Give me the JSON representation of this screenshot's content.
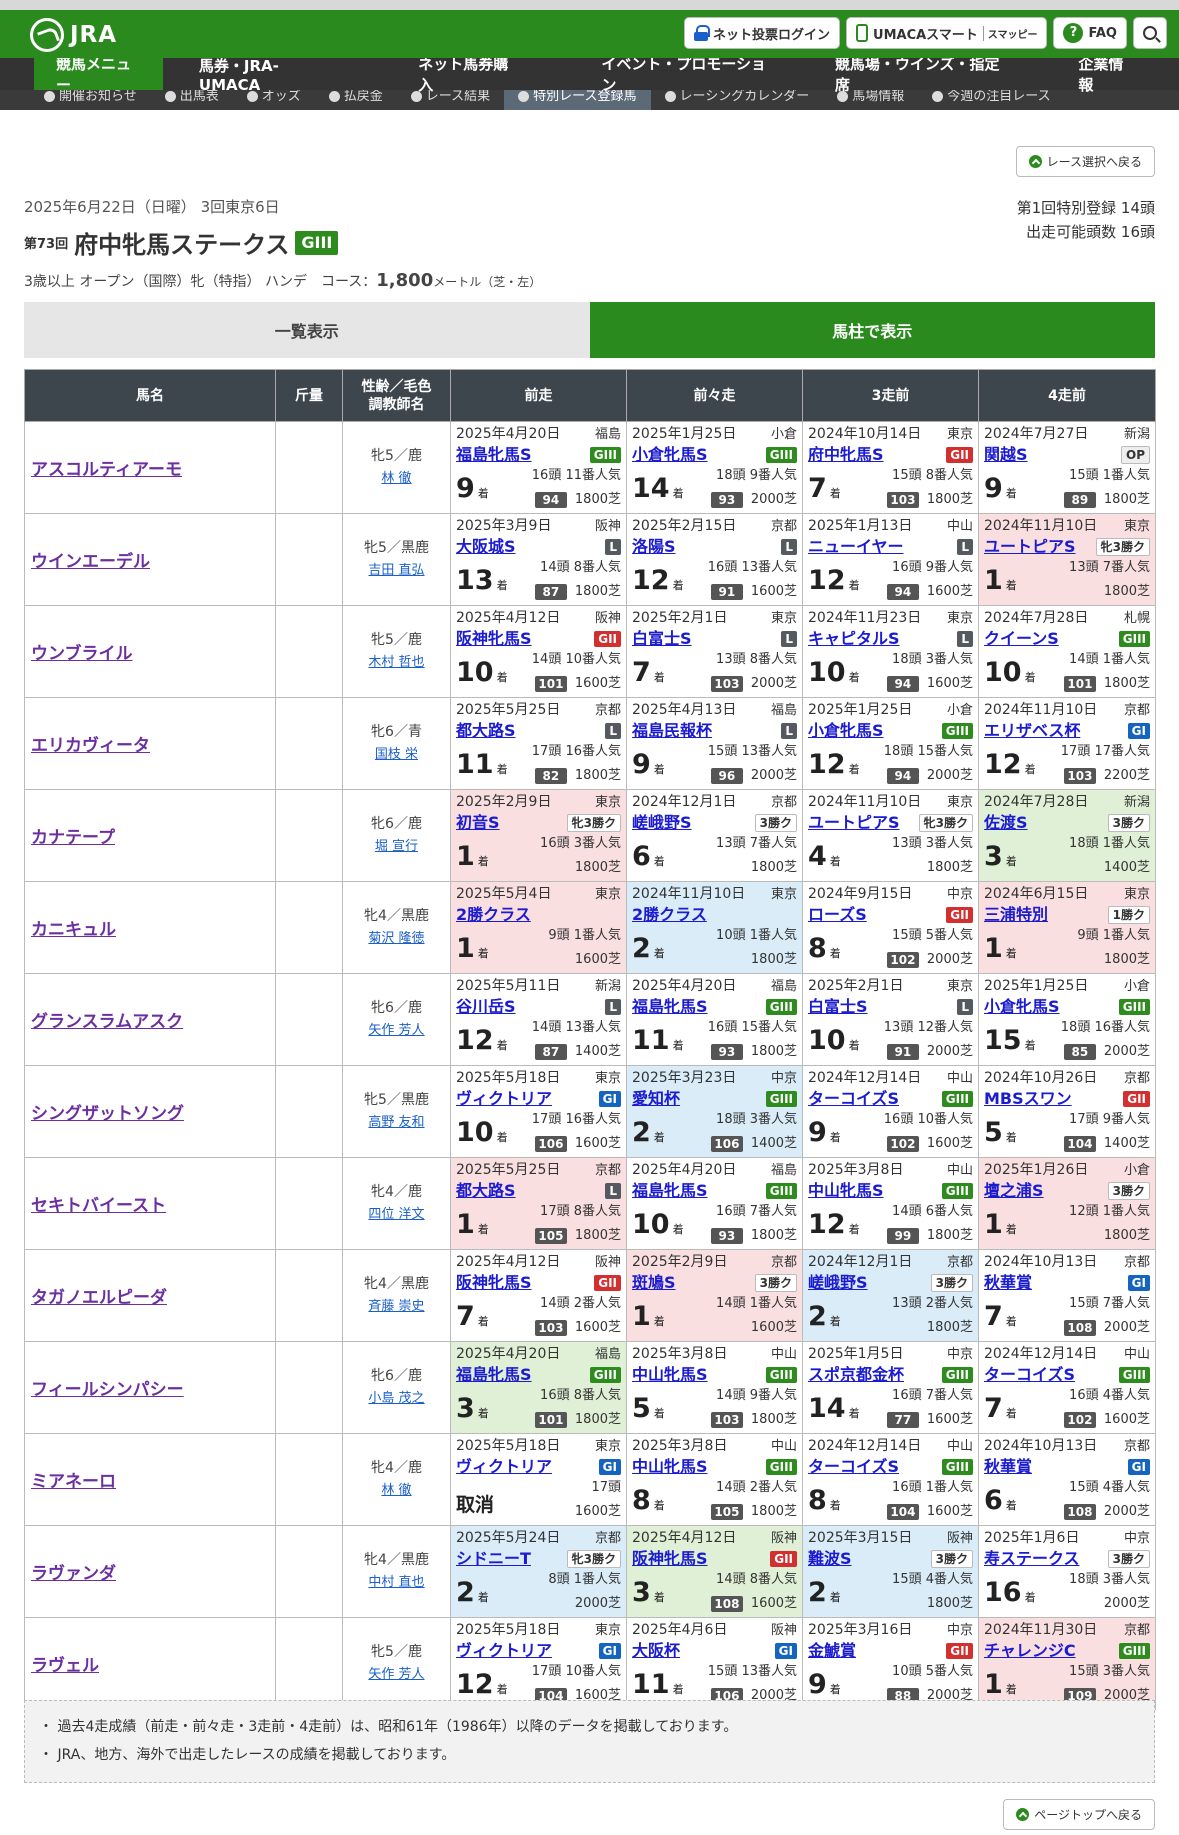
{
  "header": {
    "logo": "JRA",
    "login": "ネット投票ログイン",
    "umaca": "UMACAスマート",
    "smappy": "スマッピー",
    "faq": "FAQ"
  },
  "nav": [
    "競馬メニュー",
    "馬券・JRA-UMACA",
    "ネット馬券購入",
    "イベント・プロモーション",
    "競馬場・ウインズ・指定席",
    "企業情報"
  ],
  "subnav": [
    "開催お知らせ",
    "出馬表",
    "オッズ",
    "払戻金",
    "レース結果",
    "特別レース登録馬",
    "レーシングカレンダー",
    "馬場情報",
    "今週の注目レース"
  ],
  "back_label": "レース選択へ戻る",
  "race": {
    "date": "2025年6月22日（日曜） 3回東京6日",
    "number": "第73回",
    "name": "府中牝馬ステークス",
    "grade": "GIII",
    "cond_prefix": "3歳以上 オープン（国際）牝（特指） ハンデ　コース：",
    "distance": "1,800",
    "cond_suffix": "メートル（芝・左）",
    "reg1": "第1回特別登録 14頭",
    "reg2": "出走可能頭数 16頭"
  },
  "tabs": {
    "list": "一覧表示",
    "column": "馬柱で表示"
  },
  "columns": {
    "name": "馬名",
    "weight": "斤量",
    "attr": "性齢／毛色\n調教師名",
    "prev1": "前走",
    "prev2": "前々走",
    "prev3": "3走前",
    "prev4": "4走前"
  },
  "horses": [
    {
      "name": "アスコルティアーモ",
      "sex": "牝5／鹿",
      "trainer": "林 徹",
      "races": [
        {
          "d": "2025年4月20日",
          "v": "福島",
          "n": "福島牝馬S",
          "g": "GIII",
          "p": "9",
          "h": "16頭 11番人気",
          "r": "94",
          "c": "1800芝",
          "bg": ""
        },
        {
          "d": "2025年1月25日",
          "v": "小倉",
          "n": "小倉牝馬S",
          "g": "GIII",
          "p": "14",
          "h": "18頭 9番人気",
          "r": "93",
          "c": "2000芝",
          "bg": ""
        },
        {
          "d": "2024年10月14日",
          "v": "東京",
          "n": "府中牝馬S",
          "g": "GII",
          "p": "7",
          "h": "15頭 8番人気",
          "r": "103",
          "c": "1800芝",
          "bg": ""
        },
        {
          "d": "2024年7月27日",
          "v": "新潟",
          "n": "関越S",
          "g": "OP",
          "p": "9",
          "h": "15頭 1番人気",
          "r": "89",
          "c": "1800芝",
          "bg": ""
        }
      ]
    },
    {
      "name": "ウインエーデル",
      "sex": "牝5／黒鹿",
      "trainer": "吉田 直弘",
      "races": [
        {
          "d": "2025年3月9日",
          "v": "阪神",
          "n": "大阪城S",
          "g": "L",
          "p": "13",
          "h": "14頭 8番人気",
          "r": "87",
          "c": "1800芝",
          "bg": ""
        },
        {
          "d": "2025年2月15日",
          "v": "京都",
          "n": "洛陽S",
          "g": "L",
          "p": "12",
          "h": "16頭 13番人気",
          "r": "91",
          "c": "1600芝",
          "bg": ""
        },
        {
          "d": "2025年1月13日",
          "v": "中山",
          "n": "ニューイヤー",
          "g": "L",
          "p": "12",
          "h": "16頭 9番人気",
          "r": "94",
          "c": "1600芝",
          "bg": ""
        },
        {
          "d": "2024年11月10日",
          "v": "東京",
          "n": "ユートピアS",
          "g": "牝3勝ク",
          "p": "1",
          "h": "13頭 7番人気",
          "r": "",
          "c": "1800芝",
          "bg": "w"
        }
      ]
    },
    {
      "name": "ウンブライル",
      "sex": "牝5／鹿",
      "trainer": "木村 哲也",
      "races": [
        {
          "d": "2025年4月12日",
          "v": "阪神",
          "n": "阪神牝馬S",
          "g": "GII",
          "p": "10",
          "h": "14頭 10番人気",
          "r": "101",
          "c": "1600芝",
          "bg": ""
        },
        {
          "d": "2025年2月1日",
          "v": "東京",
          "n": "白富士S",
          "g": "L",
          "p": "7",
          "h": "13頭 8番人気",
          "r": "103",
          "c": "2000芝",
          "bg": ""
        },
        {
          "d": "2024年11月23日",
          "v": "東京",
          "n": "キャピタルS",
          "g": "L",
          "p": "10",
          "h": "18頭 3番人気",
          "r": "94",
          "c": "1600芝",
          "bg": ""
        },
        {
          "d": "2024年7月28日",
          "v": "札幌",
          "n": "クイーンS",
          "g": "GIII",
          "p": "10",
          "h": "14頭 1番人気",
          "r": "101",
          "c": "1800芝",
          "bg": ""
        }
      ]
    },
    {
      "name": "エリカヴィータ",
      "sex": "牝6／青",
      "trainer": "国枝 栄",
      "races": [
        {
          "d": "2025年5月25日",
          "v": "京都",
          "n": "都大路S",
          "g": "L",
          "p": "11",
          "h": "17頭 16番人気",
          "r": "82",
          "c": "1800芝",
          "bg": ""
        },
        {
          "d": "2025年4月13日",
          "v": "福島",
          "n": "福島民報杯",
          "g": "L",
          "p": "9",
          "h": "15頭 13番人気",
          "r": "96",
          "c": "2000芝",
          "bg": ""
        },
        {
          "d": "2025年1月25日",
          "v": "小倉",
          "n": "小倉牝馬S",
          "g": "GIII",
          "p": "12",
          "h": "18頭 15番人気",
          "r": "94",
          "c": "2000芝",
          "bg": ""
        },
        {
          "d": "2024年11月10日",
          "v": "京都",
          "n": "エリザベス杯",
          "g": "GI",
          "p": "12",
          "h": "17頭 17番人気",
          "r": "103",
          "c": "2200芝",
          "bg": ""
        }
      ]
    },
    {
      "name": "カナテープ",
      "sex": "牝6／鹿",
      "trainer": "堀 宣行",
      "races": [
        {
          "d": "2025年2月9日",
          "v": "東京",
          "n": "初音S",
          "g": "牝3勝ク",
          "p": "1",
          "h": "16頭 3番人気",
          "r": "",
          "c": "1800芝",
          "bg": "w"
        },
        {
          "d": "2024年12月1日",
          "v": "京都",
          "n": "嵯峨野S",
          "g": "3勝ク",
          "p": "6",
          "h": "13頭 7番人気",
          "r": "",
          "c": "1800芝",
          "bg": ""
        },
        {
          "d": "2024年11月10日",
          "v": "東京",
          "n": "ユートピアS",
          "g": "牝3勝ク",
          "p": "4",
          "h": "13頭 3番人気",
          "r": "",
          "c": "1800芝",
          "bg": ""
        },
        {
          "d": "2024年7月28日",
          "v": "新潟",
          "n": "佐渡S",
          "g": "3勝ク",
          "p": "3",
          "h": "18頭 1番人気",
          "r": "",
          "c": "1400芝",
          "bg": "p3"
        }
      ]
    },
    {
      "name": "カニキュル",
      "sex": "牝4／黒鹿",
      "trainer": "菊沢 隆徳",
      "races": [
        {
          "d": "2025年5月4日",
          "v": "東京",
          "n": "2勝クラス",
          "g": "",
          "p": "1",
          "h": "9頭 1番人気",
          "r": "",
          "c": "1600芝",
          "bg": "w"
        },
        {
          "d": "2024年11月10日",
          "v": "東京",
          "n": "2勝クラス",
          "g": "",
          "p": "2",
          "h": "10頭 1番人気",
          "r": "",
          "c": "1800芝",
          "bg": "p2"
        },
        {
          "d": "2024年9月15日",
          "v": "中京",
          "n": "ローズS",
          "g": "GII",
          "p": "8",
          "h": "15頭 5番人気",
          "r": "102",
          "c": "2000芝",
          "bg": ""
        },
        {
          "d": "2024年6月15日",
          "v": "東京",
          "n": "三浦特別",
          "g": "1勝ク",
          "p": "1",
          "h": "9頭 1番人気",
          "r": "",
          "c": "1800芝",
          "bg": "w"
        }
      ]
    },
    {
      "name": "グランスラムアスク",
      "sex": "牝6／鹿",
      "trainer": "矢作 芳人",
      "races": [
        {
          "d": "2025年5月11日",
          "v": "新潟",
          "n": "谷川岳S",
          "g": "L",
          "p": "12",
          "h": "14頭 13番人気",
          "r": "87",
          "c": "1400芝",
          "bg": ""
        },
        {
          "d": "2025年4月20日",
          "v": "福島",
          "n": "福島牝馬S",
          "g": "GIII",
          "p": "11",
          "h": "16頭 15番人気",
          "r": "93",
          "c": "1800芝",
          "bg": ""
        },
        {
          "d": "2025年2月1日",
          "v": "東京",
          "n": "白富士S",
          "g": "L",
          "p": "10",
          "h": "13頭 12番人気",
          "r": "91",
          "c": "2000芝",
          "bg": ""
        },
        {
          "d": "2025年1月25日",
          "v": "小倉",
          "n": "小倉牝馬S",
          "g": "GIII",
          "p": "15",
          "h": "18頭 16番人気",
          "r": "85",
          "c": "2000芝",
          "bg": ""
        }
      ]
    },
    {
      "name": "シングザットソング",
      "sex": "牝5／黒鹿",
      "trainer": "高野 友和",
      "races": [
        {
          "d": "2025年5月18日",
          "v": "東京",
          "n": "ヴィクトリア",
          "g": "GI",
          "p": "10",
          "h": "17頭 16番人気",
          "r": "106",
          "c": "1600芝",
          "bg": ""
        },
        {
          "d": "2025年3月23日",
          "v": "中京",
          "n": "愛知杯",
          "g": "GIII",
          "p": "2",
          "h": "18頭 3番人気",
          "r": "106",
          "c": "1400芝",
          "bg": "p2"
        },
        {
          "d": "2024年12月14日",
          "v": "中山",
          "n": "ターコイズS",
          "g": "GIII",
          "p": "9",
          "h": "16頭 10番人気",
          "r": "102",
          "c": "1600芝",
          "bg": ""
        },
        {
          "d": "2024年10月26日",
          "v": "京都",
          "n": "MBSスワン",
          "g": "GII",
          "p": "5",
          "h": "17頭 9番人気",
          "r": "104",
          "c": "1400芝",
          "bg": ""
        }
      ]
    },
    {
      "name": "セキトバイースト",
      "sex": "牝4／鹿",
      "trainer": "四位 洋文",
      "races": [
        {
          "d": "2025年5月25日",
          "v": "京都",
          "n": "都大路S",
          "g": "L",
          "p": "1",
          "h": "17頭 8番人気",
          "r": "105",
          "c": "1800芝",
          "bg": "w"
        },
        {
          "d": "2025年4月20日",
          "v": "福島",
          "n": "福島牝馬S",
          "g": "GIII",
          "p": "10",
          "h": "16頭 7番人気",
          "r": "93",
          "c": "1800芝",
          "bg": ""
        },
        {
          "d": "2025年3月8日",
          "v": "中山",
          "n": "中山牝馬S",
          "g": "GIII",
          "p": "12",
          "h": "14頭 6番人気",
          "r": "99",
          "c": "1800芝",
          "bg": ""
        },
        {
          "d": "2025年1月26日",
          "v": "小倉",
          "n": "壇之浦S",
          "g": "3勝ク",
          "p": "1",
          "h": "12頭 1番人気",
          "r": "",
          "c": "1800芝",
          "bg": "w"
        }
      ]
    },
    {
      "name": "タガノエルピーダ",
      "sex": "牝4／黒鹿",
      "trainer": "斉藤 崇史",
      "races": [
        {
          "d": "2025年4月12日",
          "v": "阪神",
          "n": "阪神牝馬S",
          "g": "GII",
          "p": "7",
          "h": "14頭 2番人気",
          "r": "103",
          "c": "1600芝",
          "bg": ""
        },
        {
          "d": "2025年2月9日",
          "v": "京都",
          "n": "斑鳩S",
          "g": "3勝ク",
          "p": "1",
          "h": "14頭 1番人気",
          "r": "",
          "c": "1600芝",
          "bg": "w"
        },
        {
          "d": "2024年12月1日",
          "v": "京都",
          "n": "嵯峨野S",
          "g": "3勝ク",
          "p": "2",
          "h": "13頭 2番人気",
          "r": "",
          "c": "1800芝",
          "bg": "p2"
        },
        {
          "d": "2024年10月13日",
          "v": "京都",
          "n": "秋華賞",
          "g": "GI",
          "p": "7",
          "h": "15頭 7番人気",
          "r": "108",
          "c": "2000芝",
          "bg": ""
        }
      ]
    },
    {
      "name": "フィールシンパシー",
      "sex": "牝6／鹿",
      "trainer": "小島 茂之",
      "races": [
        {
          "d": "2025年4月20日",
          "v": "福島",
          "n": "福島牝馬S",
          "g": "GIII",
          "p": "3",
          "h": "16頭 8番人気",
          "r": "101",
          "c": "1800芝",
          "bg": "p3"
        },
        {
          "d": "2025年3月8日",
          "v": "中山",
          "n": "中山牝馬S",
          "g": "GIII",
          "p": "5",
          "h": "14頭 9番人気",
          "r": "103",
          "c": "1800芝",
          "bg": ""
        },
        {
          "d": "2025年1月5日",
          "v": "中京",
          "n": "スポ京都金杯",
          "g": "GIII",
          "p": "14",
          "h": "16頭 7番人気",
          "r": "77",
          "c": "1600芝",
          "bg": ""
        },
        {
          "d": "2024年12月14日",
          "v": "中山",
          "n": "ターコイズS",
          "g": "GIII",
          "p": "7",
          "h": "16頭 4番人気",
          "r": "102",
          "c": "1600芝",
          "bg": ""
        }
      ]
    },
    {
      "name": "ミアネーロ",
      "sex": "牝4／鹿",
      "trainer": "林 徹",
      "races": [
        {
          "d": "2025年5月18日",
          "v": "東京",
          "n": "ヴィクトリア",
          "g": "GI",
          "p": "取消",
          "h": "17頭",
          "r": "",
          "c": "1600芝",
          "bg": ""
        },
        {
          "d": "2025年3月8日",
          "v": "中山",
          "n": "中山牝馬S",
          "g": "GIII",
          "p": "8",
          "h": "14頭 2番人気",
          "r": "105",
          "c": "1800芝",
          "bg": ""
        },
        {
          "d": "2024年12月14日",
          "v": "中山",
          "n": "ターコイズS",
          "g": "GIII",
          "p": "8",
          "h": "16頭 1番人気",
          "r": "104",
          "c": "1600芝",
          "bg": ""
        },
        {
          "d": "2024年10月13日",
          "v": "京都",
          "n": "秋華賞",
          "g": "GI",
          "p": "6",
          "h": "15頭 4番人気",
          "r": "108",
          "c": "2000芝",
          "bg": ""
        }
      ]
    },
    {
      "name": "ラヴァンダ",
      "sex": "牝4／黒鹿",
      "trainer": "中村 直也",
      "races": [
        {
          "d": "2025年5月24日",
          "v": "京都",
          "n": "シドニーT",
          "g": "牝3勝ク",
          "p": "2",
          "h": "8頭 1番人気",
          "r": "",
          "c": "2000芝",
          "bg": "p2"
        },
        {
          "d": "2025年4月12日",
          "v": "阪神",
          "n": "阪神牝馬S",
          "g": "GII",
          "p": "3",
          "h": "14頭 8番人気",
          "r": "108",
          "c": "1600芝",
          "bg": "p3"
        },
        {
          "d": "2025年3月15日",
          "v": "阪神",
          "n": "難波S",
          "g": "3勝ク",
          "p": "2",
          "h": "15頭 4番人気",
          "r": "",
          "c": "1800芝",
          "bg": "p2"
        },
        {
          "d": "2025年1月6日",
          "v": "中京",
          "n": "寿ステークス",
          "g": "3勝ク",
          "p": "16",
          "h": "18頭 3番人気",
          "r": "",
          "c": "2000芝",
          "bg": ""
        }
      ]
    },
    {
      "name": "ラヴェル",
      "sex": "牝5／鹿",
      "trainer": "矢作 芳人",
      "races": [
        {
          "d": "2025年5月18日",
          "v": "東京",
          "n": "ヴィクトリア",
          "g": "GI",
          "p": "12",
          "h": "17頭 10番人気",
          "r": "104",
          "c": "1600芝",
          "bg": ""
        },
        {
          "d": "2025年4月6日",
          "v": "阪神",
          "n": "大阪杯",
          "g": "GI",
          "p": "11",
          "h": "15頭 13番人気",
          "r": "106",
          "c": "2000芝",
          "bg": ""
        },
        {
          "d": "2025年3月16日",
          "v": "中京",
          "n": "金鯱賞",
          "g": "GII",
          "p": "9",
          "h": "10頭 5番人気",
          "r": "88",
          "c": "2000芝",
          "bg": ""
        },
        {
          "d": "2024年11月30日",
          "v": "京都",
          "n": "チャレンジC",
          "g": "GIII",
          "p": "1",
          "h": "15頭 3番人気",
          "r": "109",
          "c": "2000芝",
          "bg": "w"
        }
      ]
    }
  ],
  "place_suffix": "着",
  "notes": [
    "・ 過去4走成績（前走・前々走・3走前・4走前）は、昭和61年（1986年）以降のデータを掲載しております。",
    "・ JRA、地方、海外で出走したレースの成績を掲載しております。"
  ],
  "pagetop_label": "ページトップへ戻る"
}
